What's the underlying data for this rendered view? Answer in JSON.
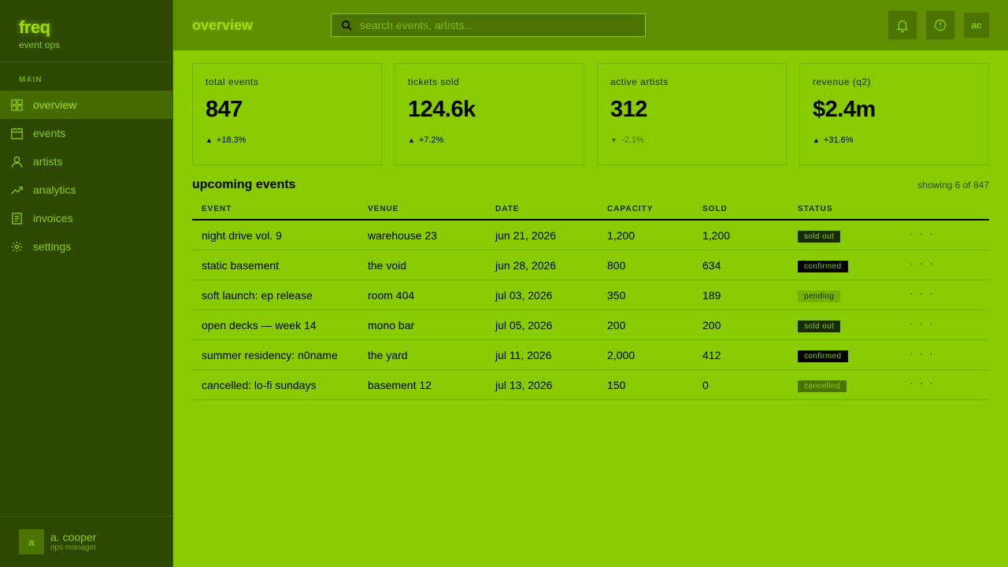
{
  "brand": {
    "name": "freq",
    "sub": "event ops"
  },
  "nav": {
    "section": "MAIN",
    "items": [
      {
        "label": "overview",
        "icon": "grid-icon",
        "active": true
      },
      {
        "label": "events",
        "icon": "calendar-icon"
      },
      {
        "label": "artists",
        "icon": "user-icon"
      },
      {
        "label": "analytics",
        "icon": "trend-icon"
      },
      {
        "label": "invoices",
        "icon": "document-icon"
      },
      {
        "label": "settings",
        "icon": "gear-icon"
      }
    ]
  },
  "user": {
    "initial": "a",
    "name": "a. cooper",
    "role": "ops manager"
  },
  "header": {
    "title": "overview",
    "search_placeholder": "search events, artists...",
    "avatar": "ac"
  },
  "kpis": [
    {
      "label": "total events",
      "value": "847",
      "delta": "+18.3%",
      "trend": "up"
    },
    {
      "label": "tickets sold",
      "value": "124.6k",
      "delta": "+7.2%",
      "trend": "up"
    },
    {
      "label": "active artists",
      "value": "312",
      "delta": "-2.1%",
      "trend": "down"
    },
    {
      "label": "revenue (q2)",
      "value": "$2.4m",
      "delta": "+31.6%",
      "trend": "up"
    }
  ],
  "table": {
    "title": "upcoming events",
    "count": "showing 6 of 847",
    "columns": [
      "EVENT",
      "VENUE",
      "DATE",
      "CAPACITY",
      "SOLD",
      "STATUS"
    ],
    "actions_label": "· · ·",
    "rows": [
      {
        "event": "night drive vol. 9",
        "venue": "warehouse 23",
        "date": "jun 21, 2026",
        "capacity": "1,200",
        "sold": "1,200",
        "status": "sold out",
        "status_kind": "soldout"
      },
      {
        "event": "static basement",
        "venue": "the void",
        "date": "jun 28, 2026",
        "capacity": "800",
        "sold": "634",
        "status": "confirmed",
        "status_kind": "confirmed"
      },
      {
        "event": "soft launch: ep release",
        "venue": "room 404",
        "date": "jul 03, 2026",
        "capacity": "350",
        "sold": "189",
        "status": "pending",
        "status_kind": "pending"
      },
      {
        "event": "open decks — week 14",
        "venue": "mono bar",
        "date": "jul 05, 2026",
        "capacity": "200",
        "sold": "200",
        "status": "sold out",
        "status_kind": "soldout"
      },
      {
        "event": "summer residency: n0name",
        "venue": "the yard",
        "date": "jul 11, 2026",
        "capacity": "2,000",
        "sold": "412",
        "status": "confirmed",
        "status_kind": "confirmed"
      },
      {
        "event": "cancelled: lo-fi sundays",
        "venue": "basement 12",
        "date": "jul 13, 2026",
        "capacity": "150",
        "sold": "0",
        "status": "cancelled",
        "status_kind": "cancelled"
      }
    ]
  }
}
